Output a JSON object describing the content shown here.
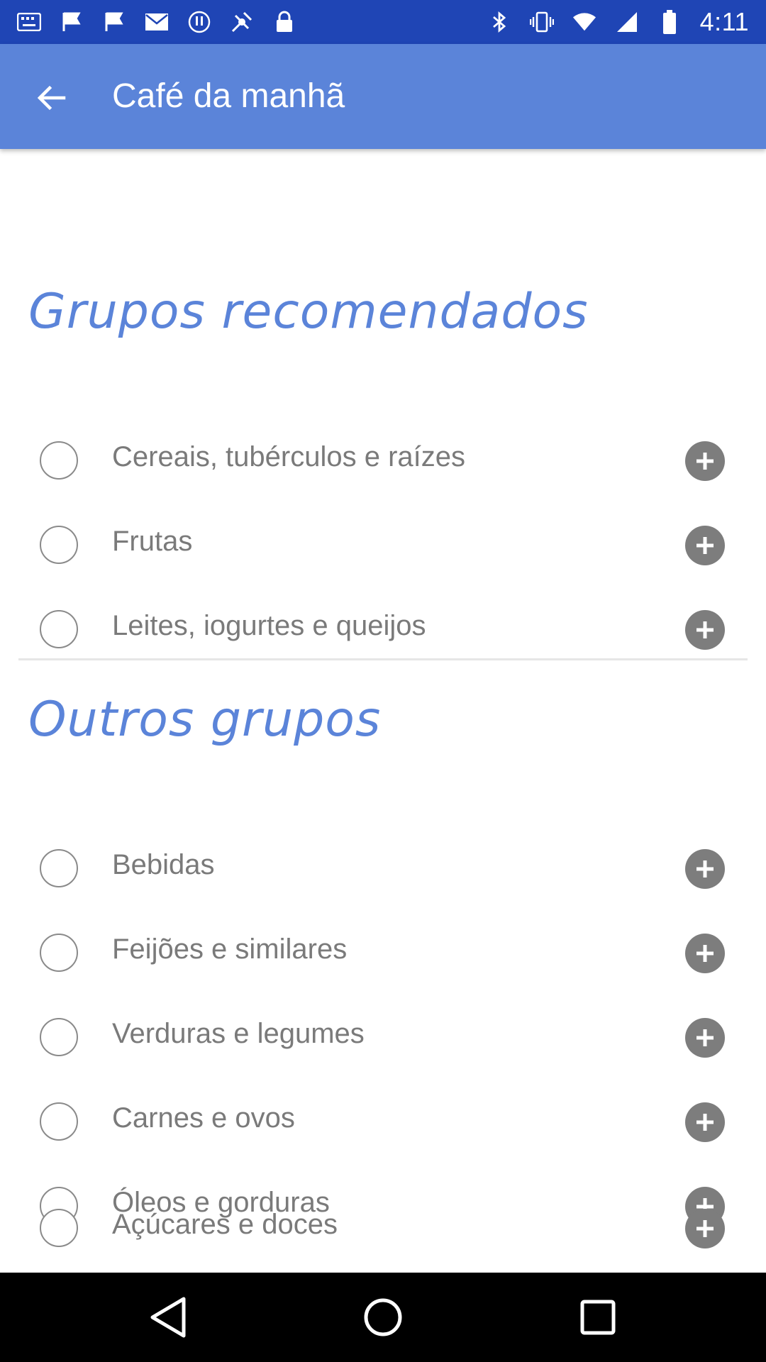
{
  "status_bar": {
    "time": "4:11",
    "left_icons": [
      "keyboard-icon",
      "flag-icon",
      "flag-icon",
      "mail-icon",
      "alert-icon",
      "location-icon",
      "lock-icon"
    ],
    "right_icons": [
      "bluetooth-icon",
      "vibrate-icon",
      "wifi-icon",
      "signal-icon",
      "battery-icon"
    ],
    "color": "#1f45b5"
  },
  "app_bar": {
    "title": "Café da manhã",
    "color": "#5b84d9"
  },
  "recommended": {
    "title": "Grupos recomendados",
    "items": [
      {
        "label": "Cereais, tubérculos e raízes"
      },
      {
        "label": "Frutas"
      },
      {
        "label": "Leites, iogurtes e queijos"
      }
    ]
  },
  "others": {
    "title": "Outros grupos",
    "items": [
      {
        "label": "Bebidas"
      },
      {
        "label": "Feijões e similares"
      },
      {
        "label": "Verduras e legumes"
      },
      {
        "label": "Carnes e ovos"
      },
      {
        "label": "Óleos e gorduras"
      },
      {
        "label": "Açúcares e doces"
      }
    ]
  },
  "accent_color": "#5b84d9"
}
